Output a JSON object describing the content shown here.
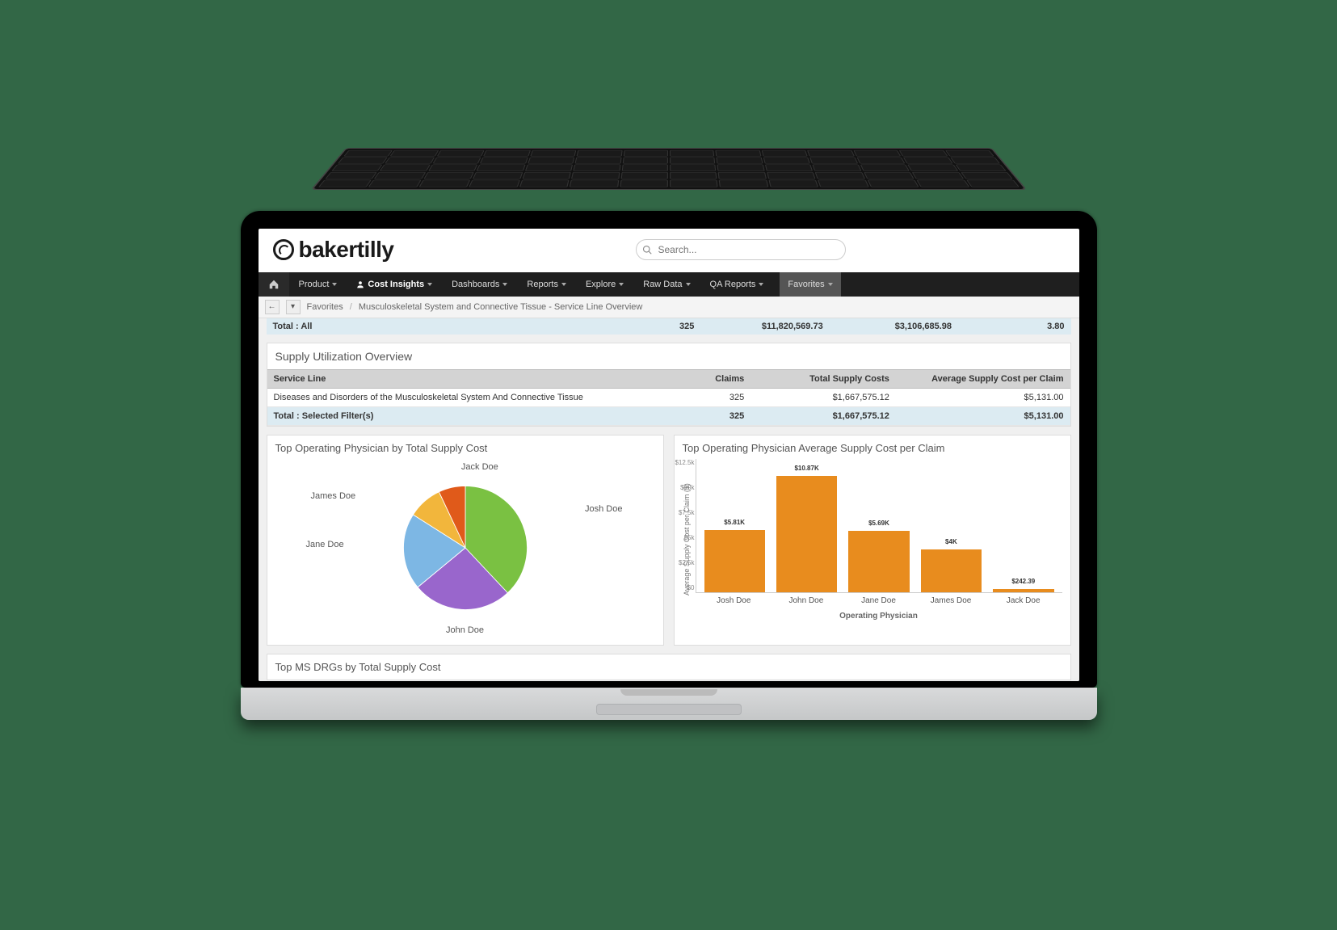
{
  "logo_text": "bakertilly",
  "search": {
    "placeholder": "Search..."
  },
  "nav": {
    "items": [
      {
        "label": "Product"
      },
      {
        "label": "Cost Insights",
        "active": true
      },
      {
        "label": "Dashboards"
      },
      {
        "label": "Reports"
      },
      {
        "label": "Explore"
      },
      {
        "label": "Raw Data"
      },
      {
        "label": "QA Reports"
      }
    ],
    "favorites_label": "Favorites"
  },
  "breadcrumb": {
    "root": "Favorites",
    "page": "Musculoskeletal System and Connective Tissue - Service Line Overview"
  },
  "top_summary": {
    "label": "Total : All",
    "c1": "325",
    "c2": "$11,820,569.73",
    "c3": "$3,106,685.98",
    "c4": "3.80"
  },
  "supply_panel": {
    "title": "Supply Utilization Overview",
    "headers": {
      "h1": "Service Line",
      "h2": "Claims",
      "h3": "Total Supply Costs",
      "h4": "Average Supply Cost per Claim"
    },
    "row": {
      "name": "Diseases and Disorders of the Musculoskeletal System And Connective Tissue",
      "claims": "325",
      "total": "$1,667,575.12",
      "avg": "$5,131.00"
    },
    "total_row": {
      "name": "Total : Selected Filter(s)",
      "claims": "325",
      "total": "$1,667,575.12",
      "avg": "$5,131.00"
    }
  },
  "pie": {
    "title": "Top Operating Physician by Total Supply Cost",
    "labels": {
      "top": "Jack Doe",
      "right": "Josh Doe",
      "bottom": "John Doe",
      "left": "Jane Doe",
      "topleft": "James Doe"
    }
  },
  "bar": {
    "title": "Top Operating Physician Average Supply Cost per Claim",
    "ylabel": "Average Supply Cost per Claim ($)",
    "xlabel": "Operating Physician",
    "ticks": {
      "t0": "$12.5k",
      "t1": "$10k",
      "t2": "$7.5k",
      "t3": "$5k",
      "t4": "$2.5k",
      "t5": "$0"
    }
  },
  "third_card_title": "Top MS DRGs by Total Supply Cost",
  "chart_data": [
    {
      "type": "pie",
      "title": "Top Operating Physician by Total Supply Cost",
      "series": [
        {
          "name": "John Doe",
          "value": 38,
          "color": "#7ac142"
        },
        {
          "name": "Josh Doe",
          "value": 26,
          "color": "#9966cc"
        },
        {
          "name": "Jane Doe",
          "value": 20,
          "color": "#7db7e4"
        },
        {
          "name": "James Doe",
          "value": 9,
          "color": "#f2b63c"
        },
        {
          "name": "Jack Doe",
          "value": 7,
          "color": "#e05a1a"
        }
      ],
      "unit": "percent_of_total_supply_cost"
    },
    {
      "type": "bar",
      "title": "Top Operating Physician Average Supply Cost per Claim",
      "xlabel": "Operating Physician",
      "ylabel": "Average Supply Cost per Claim ($)",
      "ylim": [
        0,
        12500
      ],
      "categories": [
        "Josh Doe",
        "John Doe",
        "Jane Doe",
        "James Doe",
        "Jack Doe"
      ],
      "values": [
        5810,
        10870,
        5690,
        4000,
        242.39
      ],
      "value_labels": [
        "$5.81K",
        "$10.87K",
        "$5.69K",
        "$4K",
        "$242.39"
      ],
      "color": "#e88c1e"
    }
  ]
}
